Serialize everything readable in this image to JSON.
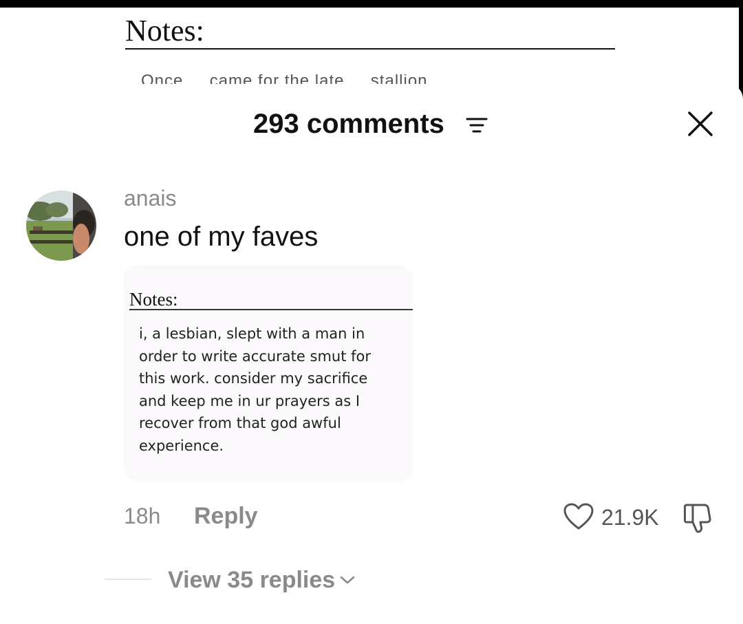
{
  "background": {
    "notes_title": "Notes:",
    "notes_partial_text": "Once ... came for the late ... stallion"
  },
  "comments_panel": {
    "count_label": "293 comments",
    "sort_icon": "sort-lines-icon",
    "close_icon": "close-x-icon"
  },
  "comment": {
    "username": "anais",
    "text": "one of my faves",
    "attached_image": {
      "notes_title": "Notes:",
      "lines": [
        "i, a lesbian, slept with a man in",
        "order to write accurate smut for",
        "this work. consider my sacrifice",
        "and keep me in ur prayers as I",
        "recover from that god awful",
        "experience."
      ]
    },
    "time": "18h",
    "reply_label": "Reply",
    "like_count": "21.9K",
    "view_replies_label": "View 35 replies"
  },
  "colors": {
    "primary_text": "#111111",
    "secondary_text": "#8a8a8a",
    "background": "#ffffff"
  }
}
